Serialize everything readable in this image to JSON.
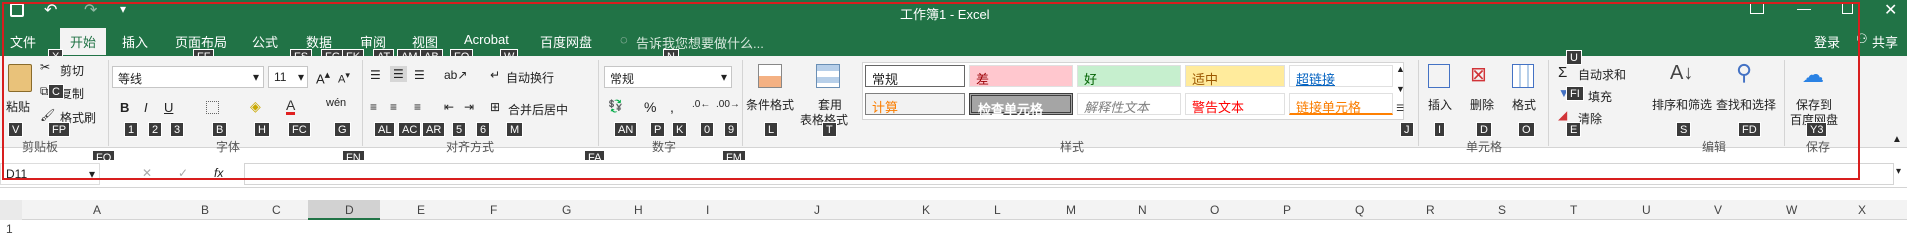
{
  "window": {
    "title": "工作簿1 - Excel",
    "login": "登录",
    "share": "共享"
  },
  "tabs": [
    "文件",
    "开始",
    "插入",
    "页面布局",
    "公式",
    "数据",
    "审阅",
    "视图",
    "Acrobat",
    "百度网盘"
  ],
  "tell_me": "告诉我您想要做什么...",
  "keytips": {
    "tabs": [
      "X",
      "FF",
      "FS",
      "FG",
      "FK",
      "AT",
      "AM",
      "AB",
      "FQ",
      "W",
      "N"
    ],
    "clip": [
      "C",
      "FP",
      "V"
    ],
    "font": [
      "1",
      "2",
      "3",
      "B",
      "H",
      "FC",
      "G"
    ],
    "align": [
      "AL",
      "AC",
      "AR",
      "5",
      "6",
      "M"
    ],
    "number": [
      "AN",
      "P",
      "K",
      "0",
      "9"
    ],
    "styles": [
      "L",
      "T",
      "J"
    ],
    "cells": [
      "I",
      "D",
      "O",
      "U",
      "FI",
      "E"
    ],
    "edit": [
      "S",
      "FD",
      "Y3"
    ],
    "groups": [
      "FO",
      "FN",
      "FA",
      "FM"
    ]
  },
  "clipboard": {
    "paste": "粘贴",
    "cut": "剪切",
    "copy": "复制",
    "painter": "格式刷",
    "group": "剪贴板"
  },
  "font": {
    "name": "等线",
    "size": "11",
    "group": "字体"
  },
  "alignment": {
    "wrap": "自动换行",
    "merge": "合并后居中",
    "group": "对齐方式"
  },
  "number": {
    "format": "常规",
    "group": "数字"
  },
  "styles": {
    "cond": "条件格式",
    "table_1": "套用",
    "table_2": "表格格式",
    "cells": [
      "常规",
      "差",
      "好",
      "适中",
      "超链接",
      "计算",
      "检查单元格",
      "解释性文本",
      "警告文本",
      "链接单元格"
    ],
    "group": "样式"
  },
  "cells_group": {
    "insert": "插入",
    "delete": "删除",
    "format": "格式",
    "group": "单元格"
  },
  "editing": {
    "autosum": "自动求和",
    "fill": "填充",
    "clear": "清除",
    "sort": "排序和筛选",
    "find": "查找和选择",
    "group": "编辑"
  },
  "save_group": {
    "save_1": "保存到",
    "save_2": "百度网盘",
    "group": "保存"
  },
  "formula_bar": {
    "name_box": "D11",
    "fx": "fx"
  },
  "columns": [
    "A",
    "B",
    "C",
    "D",
    "E",
    "F",
    "G",
    "H",
    "I",
    "J",
    "K",
    "L",
    "M",
    "N",
    "O",
    "P",
    "Q",
    "R",
    "S",
    "T",
    "U",
    "V",
    "W",
    "X"
  ],
  "row_label": "1",
  "colors": {
    "excel_green": "#217346",
    "highlight_red": "#d81e1e"
  }
}
